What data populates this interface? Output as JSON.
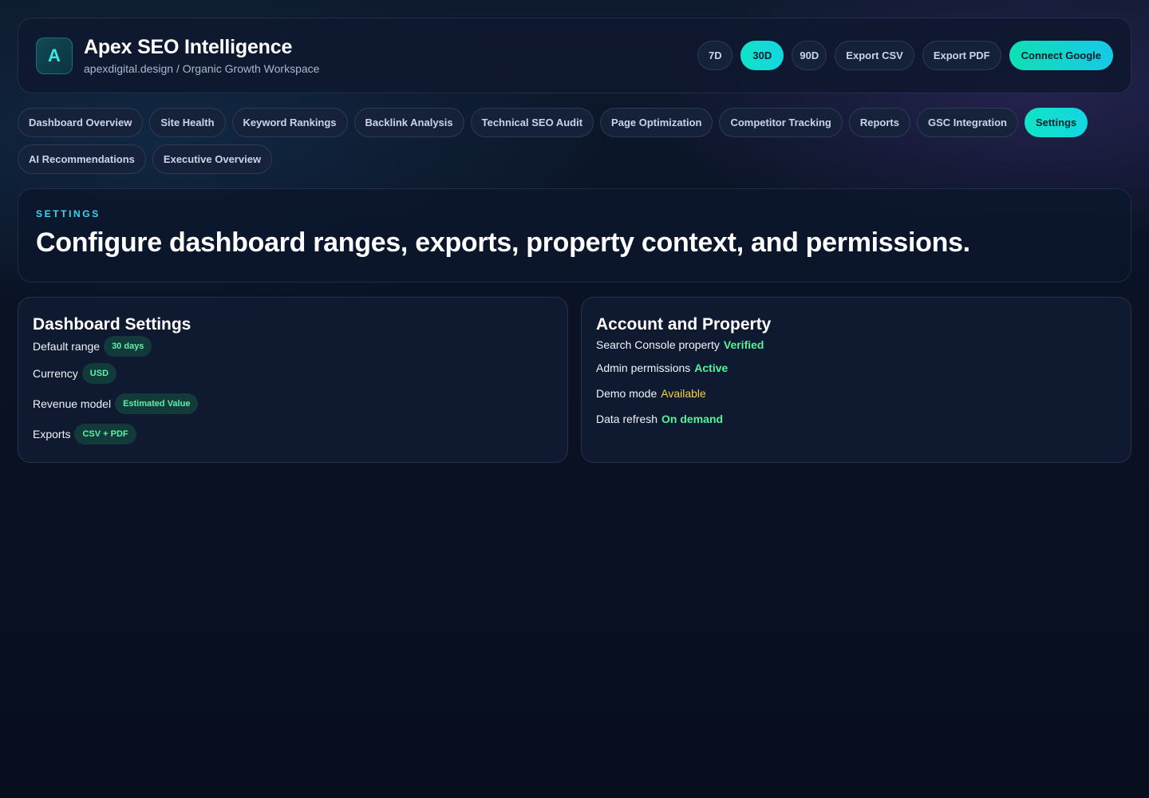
{
  "header": {
    "logo_letter": "A",
    "title": "Apex SEO Intelligence",
    "subtitle": "apexdigital.design / Organic Growth Workspace",
    "ranges": [
      "7D",
      "30D",
      "90D"
    ],
    "active_range": "30D",
    "export_csv": "Export CSV",
    "export_pdf": "Export PDF",
    "connect": "Connect Google"
  },
  "nav": {
    "tabs": [
      "Dashboard Overview",
      "Site Health",
      "Keyword Rankings",
      "Backlink Analysis",
      "Technical SEO Audit",
      "Page Optimization",
      "Competitor Tracking",
      "Reports",
      "GSC Integration",
      "Settings",
      "AI Recommendations",
      "Executive Overview"
    ],
    "active": "Settings"
  },
  "hero": {
    "eyebrow": "SETTINGS",
    "title": "Configure dashboard ranges, exports, property context, and permissions."
  },
  "dashboard_settings": {
    "title": "Dashboard Settings",
    "rows": [
      {
        "label": "Default range",
        "value": "30 days"
      },
      {
        "label": "Currency",
        "value": "USD"
      },
      {
        "label": "Revenue model",
        "value": "Estimated Value"
      },
      {
        "label": "Exports",
        "value": "CSV + PDF"
      }
    ]
  },
  "account": {
    "title": "Account and Property",
    "rows": [
      {
        "label": "Search Console property",
        "value": "Verified",
        "status": "ok"
      },
      {
        "label": "Admin permissions",
        "value": "Active",
        "status": "ok"
      },
      {
        "label": "Demo mode",
        "value": "Available",
        "status": "warn"
      },
      {
        "label": "Data refresh",
        "value": "On demand",
        "status": "ok"
      }
    ]
  },
  "colors": {
    "accent": "#14d6e0",
    "status_ok": "#4ff59a",
    "status_warn": "#f5d04a",
    "background": "#080e1e"
  }
}
